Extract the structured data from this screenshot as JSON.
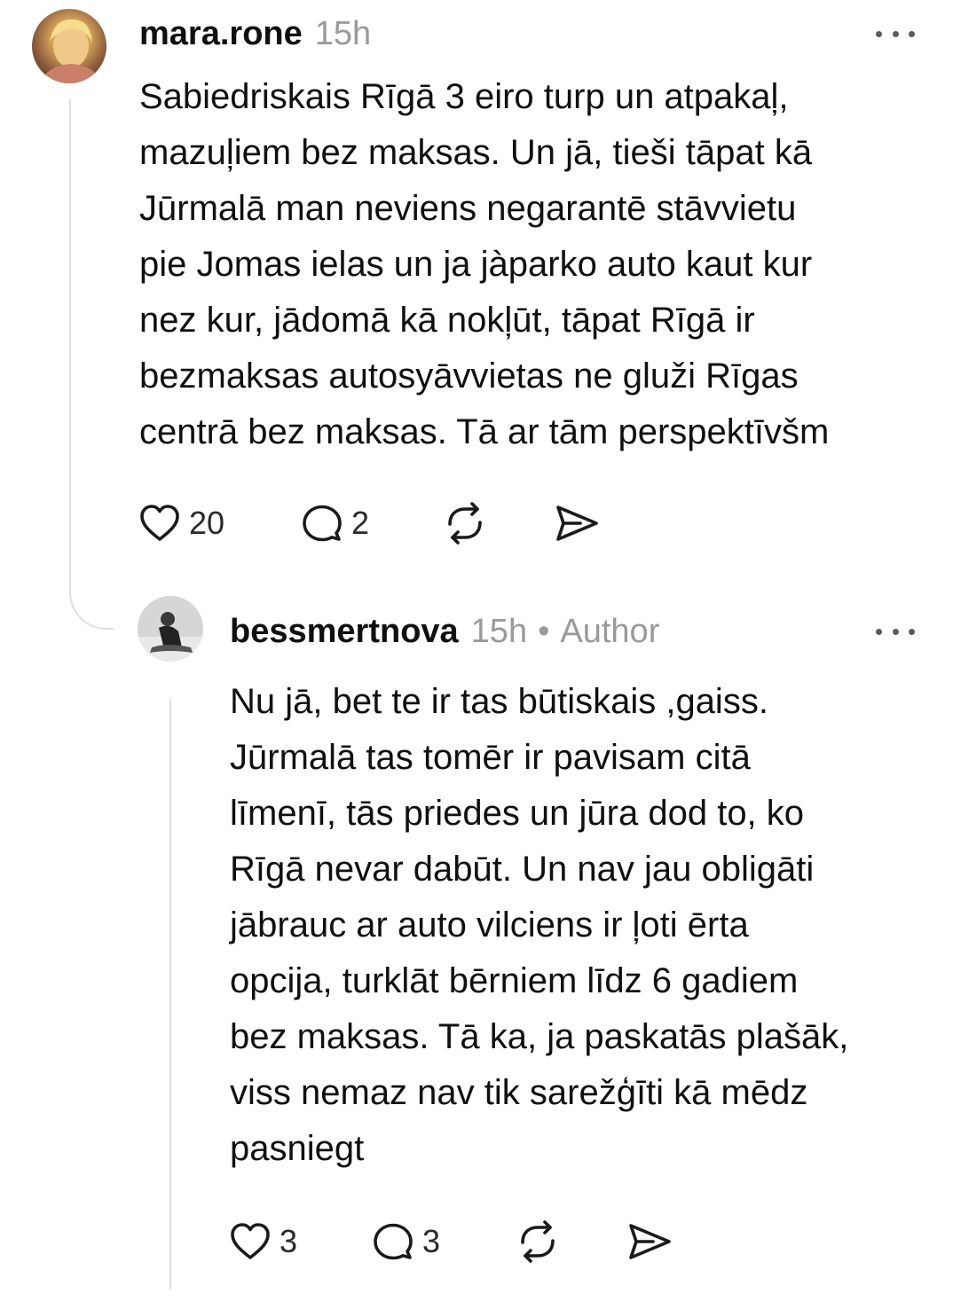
{
  "comment": {
    "username": "mara.rone",
    "time": "15h",
    "text": "Sabiedriskais Rīgā 3 eiro turp un atpakaļ,\nmazuļiem bez maksas. Un jā, tieši tāpat kā\nJūrmalā man neviens negarantē stāvvietu\npie Jomas ielas un ja jàparko auto kaut kur\nnez kur, jādomā kā nokļūt, tāpat Rīgā ir\nbezmaksas autosyāvvietas ne gluži Rīgas\ncentrā bez maksas. Tā ar tām perspektīvšm",
    "likes": "20",
    "replies": "2"
  },
  "reply": {
    "username": "bessmertnova",
    "time": "15h",
    "separator": "•",
    "badge": "Author",
    "text": "Nu jā, bet te ir tas būtiskais ,gaiss.\nJūrmalā tas tomēr ir pavisam citā\nlīmenī, tās priedes un jūra dod to, ko\nRīgā nevar dabūt. Un nav jau obligāti\njābrauc ar auto vilciens ir ļoti ērta\nopcija, turklāt bērniem līdz 6 gadiem\nbez maksas. Tā ka, ja paskatās plašāk,\nviss nemaz nav tik sarežģīti kā mēdz\npasniegt",
    "likes": "3",
    "replies": "3"
  },
  "icons": {
    "like": "heart-icon",
    "reply": "speech-bubble-icon",
    "repost": "repost-icon",
    "share": "send-icon",
    "more": "more-dots-icon"
  }
}
